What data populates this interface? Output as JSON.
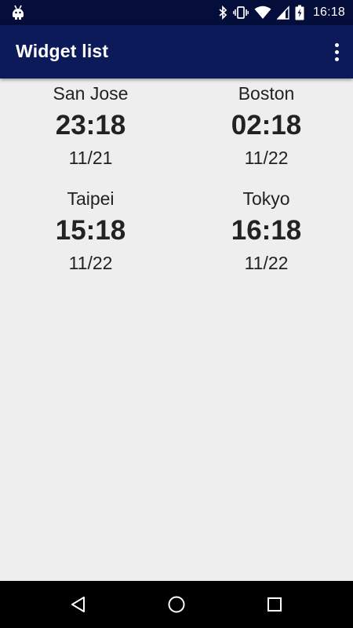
{
  "status_bar": {
    "time": "16:18",
    "icons": [
      "android-debug-icon",
      "bluetooth-icon",
      "vibrate-icon",
      "wifi-icon",
      "cell-signal-icon",
      "battery-charging-icon"
    ]
  },
  "app_bar": {
    "title": "Widget list",
    "menu_icon": "overflow-menu-icon"
  },
  "clocks": [
    {
      "city": "San Jose",
      "time": "23:18",
      "date": "11/21"
    },
    {
      "city": "Boston",
      "time": "02:18",
      "date": "11/22"
    },
    {
      "city": "Taipei",
      "time": "15:18",
      "date": "11/22"
    },
    {
      "city": "Tokyo",
      "time": "16:18",
      "date": "11/22"
    }
  ],
  "nav_bar": {
    "icons": [
      "back-icon",
      "home-icon",
      "recents-icon"
    ]
  },
  "colors": {
    "status_bar": "#050d3a",
    "app_bar": "#0c1a5a",
    "background": "#eeeeee",
    "text": "#222222"
  }
}
